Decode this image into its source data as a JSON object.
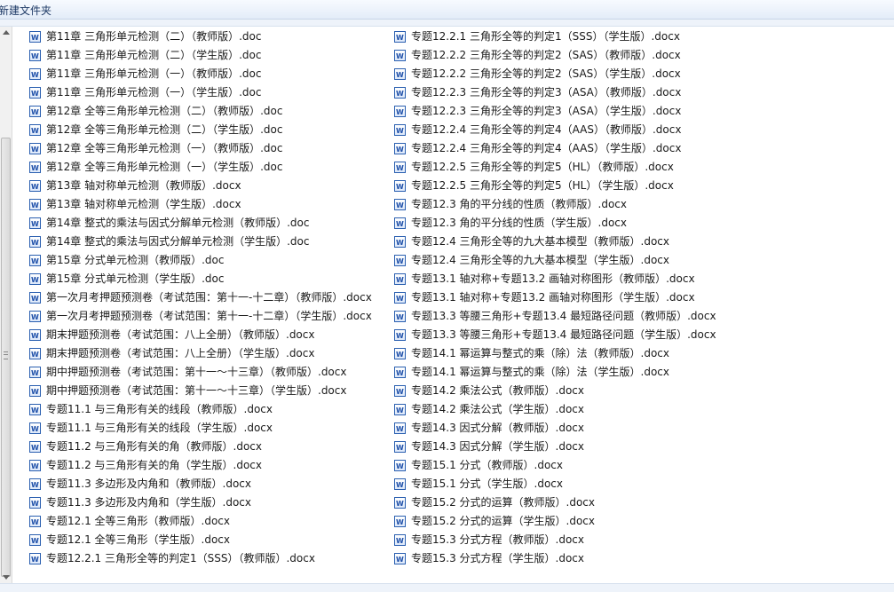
{
  "window": {
    "title": "新建文件夹"
  },
  "icon_name": "word-doc-icon",
  "files_col1": [
    "第11章  三角形单元检测（二）（教师版）.doc",
    "第11章  三角形单元检测（二）（学生版）.doc",
    "第11章  三角形单元检测（一）（教师版）.doc",
    "第11章  三角形单元检测（一）（学生版）.doc",
    "第12章  全等三角形单元检测（二）（教师版）.doc",
    "第12章  全等三角形单元检测（二）（学生版）.doc",
    "第12章  全等三角形单元检测（一）（教师版）.doc",
    "第12章  全等三角形单元检测（一）（学生版）.doc",
    "第13章  轴对称单元检测（教师版）.docx",
    "第13章  轴对称单元检测（学生版）.docx",
    "第14章  整式的乘法与因式分解单元检测（教师版）.doc",
    "第14章  整式的乘法与因式分解单元检测（学生版）.doc",
    "第15章  分式单元检测（教师版）.doc",
    "第15章  分式单元检测（学生版）.doc",
    "第一次月考押题预测卷（考试范围：第十一-十二章）（教师版）.docx",
    "第一次月考押题预测卷（考试范围：第十一-十二章）（学生版）.docx",
    "期末押题预测卷（考试范围：八上全册）（教师版）.docx",
    "期末押题预测卷（考试范围：八上全册）（学生版）.docx",
    "期中押题预测卷（考试范围：第十一～十三章）（教师版）.docx",
    "期中押题预测卷（考试范围：第十一～十三章）（学生版）.docx",
    "专题11.1 与三角形有关的线段（教师版）.docx",
    "专题11.1 与三角形有关的线段（学生版）.docx",
    "专题11.2 与三角形有关的角（教师版）.docx",
    "专题11.2 与三角形有关的角（学生版）.docx",
    "专题11.3 多边形及内角和（教师版）.docx",
    "专题11.3 多边形及内角和（学生版）.docx",
    "专题12.1 全等三角形（教师版）.docx",
    "专题12.1 全等三角形（学生版）.docx",
    "专题12.2.1 三角形全等的判定1（SSS）（教师版）.docx"
  ],
  "files_col2": [
    "专题12.2.1 三角形全等的判定1（SSS）（学生版）.docx",
    "专题12.2.2 三角形全等的判定2（SAS）（教师版）.docx",
    "专题12.2.2 三角形全等的判定2（SAS）（学生版）.docx",
    "专题12.2.3 三角形全等的判定3（ASA）（教师版）.docx",
    "专题12.2.3 三角形全等的判定3（ASA）（学生版）.docx",
    "专题12.2.4 三角形全等的判定4（AAS）（教师版）.docx",
    "专题12.2.4 三角形全等的判定4（AAS）（学生版）.docx",
    "专题12.2.5 三角形全等的判定5（HL）（教师版）.docx",
    "专题12.2.5 三角形全等的判定5（HL）（学生版）.docx",
    "专题12.3 角的平分线的性质（教师版）.docx",
    "专题12.3 角的平分线的性质（学生版）.docx",
    "专题12.4 三角形全等的九大基本模型（教师版）.docx",
    "专题12.4 三角形全等的九大基本模型（学生版）.docx",
    "专题13.1 轴对称+专题13.2 画轴对称图形（教师版）.docx",
    "专题13.1 轴对称+专题13.2 画轴对称图形（学生版）.docx",
    "专题13.3 等腰三角形+专题13.4 最短路径问题（教师版）.docx",
    "专题13.3 等腰三角形+专题13.4 最短路径问题（学生版）.docx",
    "专题14.1 幂运算与整式的乘（除）法（教师版）.docx",
    "专题14.1 幂运算与整式的乘（除）法（学生版）.docx",
    "专题14.2 乘法公式（教师版）.docx",
    "专题14.2 乘法公式（学生版）.docx",
    "专题14.3 因式分解（教师版）.docx",
    "专题14.3 因式分解（学生版）.docx",
    "专题15.1 分式（教师版）.docx",
    "专题15.1 分式（学生版）.docx",
    "专题15.2 分式的运算（教师版）.docx",
    "专题15.2 分式的运算（学生版）.docx",
    "专题15.3 分式方程（教师版）.docx",
    "专题15.3 分式方程（学生版）.docx"
  ]
}
